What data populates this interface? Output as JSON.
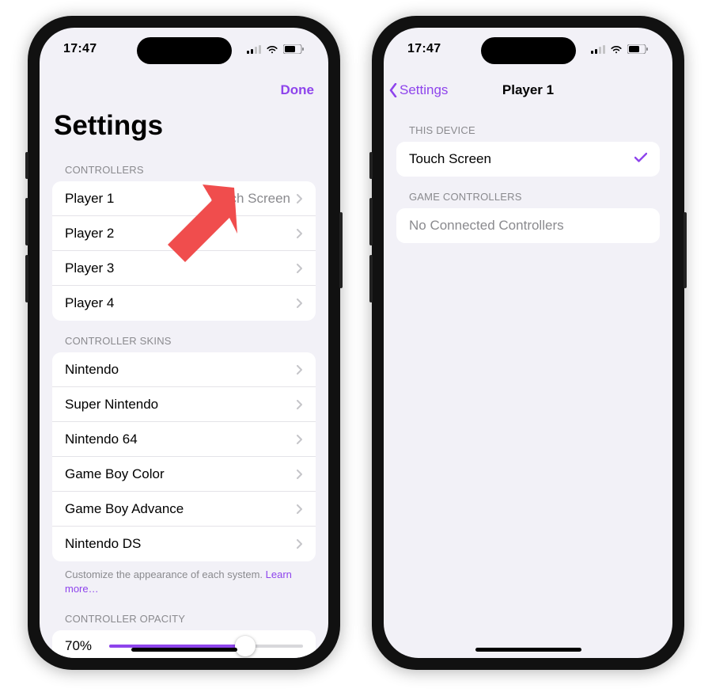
{
  "status": {
    "time": "17:47"
  },
  "left": {
    "done": "Done",
    "title": "Settings",
    "controllers_header": "CONTROLLERS",
    "controllers": [
      {
        "label": "Player 1",
        "detail": "Touch Screen"
      },
      {
        "label": "Player 2",
        "detail": ""
      },
      {
        "label": "Player 3",
        "detail": ""
      },
      {
        "label": "Player 4",
        "detail": ""
      }
    ],
    "skins_header": "CONTROLLER SKINS",
    "skins": [
      {
        "label": "Nintendo"
      },
      {
        "label": "Super Nintendo"
      },
      {
        "label": "Nintendo 64"
      },
      {
        "label": "Game Boy Color"
      },
      {
        "label": "Game Boy Advance"
      },
      {
        "label": "Nintendo DS"
      }
    ],
    "skins_footer": "Customize the appearance of each system. ",
    "learn_more": "Learn more…",
    "opacity_header": "CONTROLLER OPACITY",
    "opacity_value": "70%"
  },
  "right": {
    "back": "Settings",
    "title": "Player 1",
    "this_device_header": "THIS DEVICE",
    "this_device_option": "Touch Screen",
    "game_ctrl_header": "GAME CONTROLLERS",
    "game_ctrl_empty": "No Connected Controllers"
  }
}
